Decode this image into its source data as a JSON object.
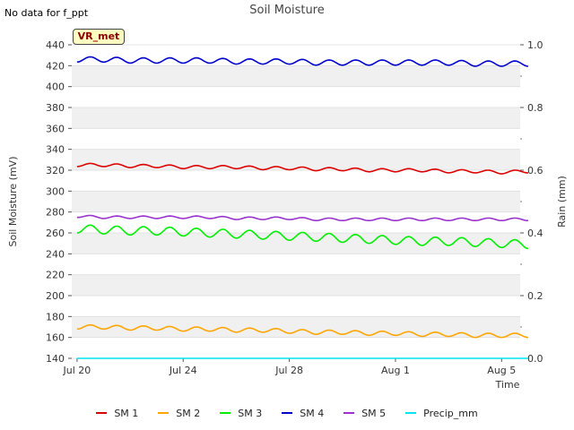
{
  "note": "No data for f_ppt",
  "chart_data": {
    "type": "line",
    "title": "Soil Moisture",
    "annotation": "VR_met",
    "xlabel": "Time",
    "ylabel": "Soil Moisture (mV)",
    "y2label": "Rain (mm)",
    "ylim": [
      140,
      440
    ],
    "y2lim": [
      0.0,
      1.0
    ],
    "xlim": [
      -0.2,
      16.7
    ],
    "x_ticks": [
      {
        "label": "Jul 20",
        "value": 0
      },
      {
        "label": "Jul 24",
        "value": 4
      },
      {
        "label": "Jul 28",
        "value": 8
      },
      {
        "label": "Aug 1",
        "value": 12
      },
      {
        "label": "Aug 5",
        "value": 16
      }
    ],
    "y_ticks": [
      140,
      160,
      180,
      200,
      220,
      240,
      260,
      280,
      300,
      320,
      340,
      360,
      380,
      400,
      420,
      440
    ],
    "y2_ticks": [
      "0.0",
      "0.2",
      "0.4",
      "0.6",
      "0.8",
      "1.0"
    ],
    "grid": "horizontal bands",
    "legend_position": "bottom",
    "series": [
      {
        "name": "SM 1",
        "color": "#dd0000",
        "x": [
          0,
          1,
          2,
          3,
          4,
          5,
          6,
          7,
          8,
          9,
          10,
          11,
          12,
          13,
          14,
          15,
          16,
          17.0
        ],
        "values": [
          325,
          325,
          324,
          324,
          323,
          323,
          323,
          322,
          322,
          321,
          321,
          320,
          320,
          320,
          319,
          319,
          318,
          319
        ],
        "amplitude": 1.5,
        "axis": "left"
      },
      {
        "name": "SM 2",
        "color": "#ffa500",
        "x": [
          0,
          1,
          2,
          3,
          4,
          5,
          6,
          7,
          8,
          9,
          10,
          11,
          12,
          13,
          14,
          15,
          16,
          17.0
        ],
        "values": [
          170,
          170,
          169,
          169,
          168,
          168,
          167,
          167,
          166,
          165,
          165,
          164,
          164,
          163,
          163,
          162,
          162,
          162
        ],
        "amplitude": 2,
        "axis": "left"
      },
      {
        "name": "SM 3",
        "color": "#00ee00",
        "x": [
          0,
          1,
          2,
          3,
          4,
          5,
          6,
          7,
          8,
          9,
          10,
          11,
          12,
          13,
          14,
          15,
          16,
          17.0
        ],
        "values": [
          264,
          263,
          262,
          262,
          261,
          260,
          259,
          258,
          257,
          256,
          255,
          254,
          253,
          252,
          252,
          251,
          250,
          249
        ],
        "amplitude": 4,
        "axis": "left"
      },
      {
        "name": "SM 4",
        "color": "#0000cc",
        "x": [
          0,
          1,
          2,
          3,
          4,
          5,
          6,
          7,
          8,
          9,
          10,
          11,
          12,
          13,
          14,
          15,
          16,
          17.0
        ],
        "values": [
          426,
          426,
          425,
          425,
          425,
          425,
          424,
          424,
          424,
          423,
          423,
          423,
          423,
          423,
          423,
          422,
          422,
          422
        ],
        "amplitude": 2.5,
        "axis": "left"
      },
      {
        "name": "SM 5",
        "color": "#9933cc",
        "x": [
          0,
          1,
          2,
          3,
          4,
          5,
          6,
          7,
          8,
          9,
          10,
          11,
          12,
          13,
          14,
          15,
          16,
          17.0
        ],
        "values": [
          276,
          275,
          275,
          275,
          275,
          275,
          274,
          274,
          274,
          273,
          273,
          273,
          273,
          273,
          273,
          273,
          273,
          273
        ],
        "amplitude": 1.2,
        "axis": "left"
      },
      {
        "name": "Precip_mm",
        "color": "#00e5ee",
        "x": [
          0,
          17.0
        ],
        "values": [
          0,
          0
        ],
        "amplitude": 0,
        "axis": "right"
      }
    ]
  }
}
